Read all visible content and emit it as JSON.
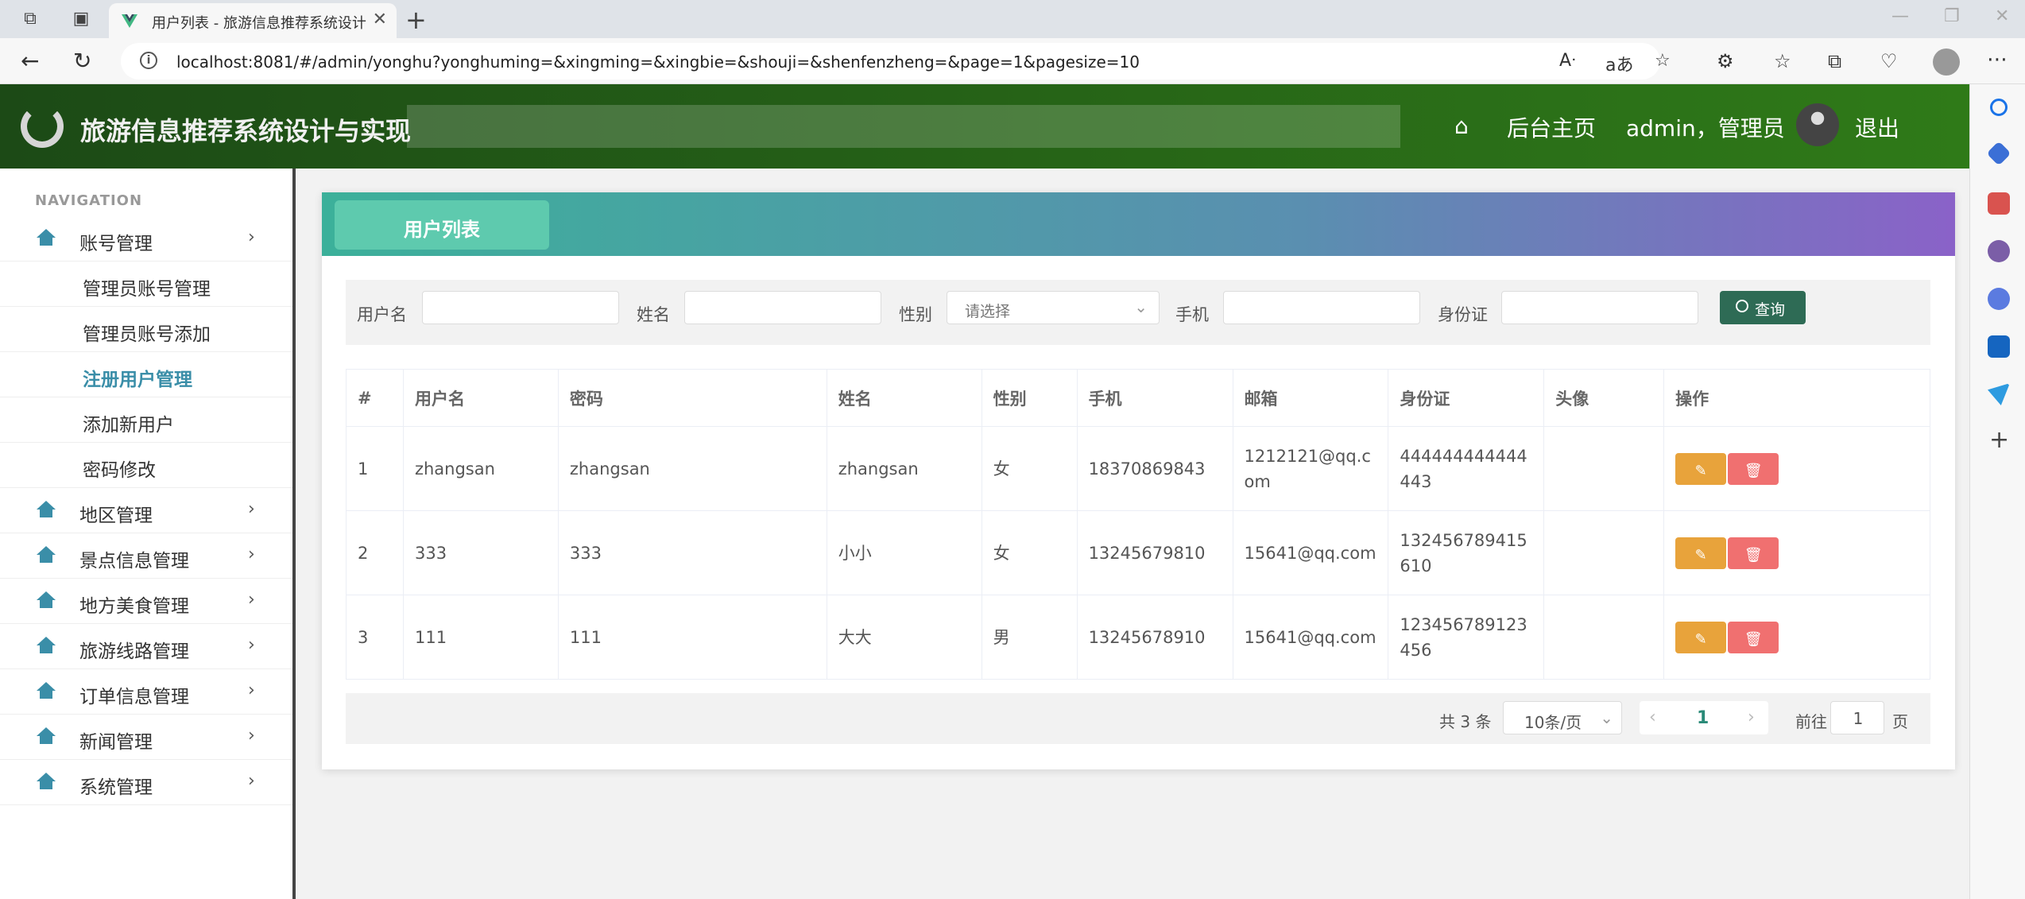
{
  "browser": {
    "tab_title": "用户列表 - 旅游信息推荐系统设计与实现",
    "url": "localhost:8081/#/admin/yonghu?yonghuming=&xingming=&xingbie=&shouji=&shenfenzheng=&page=1&pagesize=10"
  },
  "header": {
    "title": "旅游信息推荐系统设计与实现",
    "home_link": "后台主页",
    "user": "admin，管理员",
    "logout": "退出"
  },
  "sidebar": {
    "caption": "NAVIGATION",
    "groups": [
      {
        "label": "账号管理",
        "expanded": true,
        "children": [
          "管理员账号管理",
          "管理员账号添加",
          "注册用户管理",
          "添加新用户",
          "密码修改"
        ]
      },
      {
        "label": "地区管理"
      },
      {
        "label": "景点信息管理"
      },
      {
        "label": "地方美食管理"
      },
      {
        "label": "旅游线路管理"
      },
      {
        "label": "订单信息管理"
      },
      {
        "label": "新闻管理"
      },
      {
        "label": "系统管理"
      }
    ],
    "active_child": "注册用户管理"
  },
  "card": {
    "title": "用户列表"
  },
  "search": {
    "username_label": "用户名",
    "name_label": "姓名",
    "gender_label": "性别",
    "gender_placeholder": "请选择",
    "phone_label": "手机",
    "idcard_label": "身份证",
    "query_button": "查询"
  },
  "table": {
    "columns": [
      "#",
      "用户名",
      "密码",
      "姓名",
      "性别",
      "手机",
      "邮箱",
      "身份证",
      "头像",
      "操作"
    ],
    "rows": [
      [
        "1",
        "zhangsan",
        "zhangsan",
        "zhangsan",
        "女",
        "18370869843",
        "1212121@qq.com",
        "444444444444443",
        ""
      ],
      [
        "2",
        "333",
        "333",
        "小小",
        "女",
        "13245679810",
        "15641@qq.com",
        "132456789415610",
        ""
      ],
      [
        "3",
        "111",
        "111",
        "大大",
        "男",
        "13245678910",
        "15641@qq.com",
        "123456789123456",
        ""
      ]
    ]
  },
  "pagination": {
    "total": "共 3 条",
    "page_size": "10条/页",
    "current": "1",
    "goto_label": "前往",
    "goto_value": "1",
    "page_suffix": "页"
  },
  "colors": {
    "header_green": "#2f7a18",
    "accent_teal": "#3a8ea8",
    "query_button": "#2e6b55",
    "edit_button": "#e8a33b",
    "delete_button": "#f07070"
  }
}
